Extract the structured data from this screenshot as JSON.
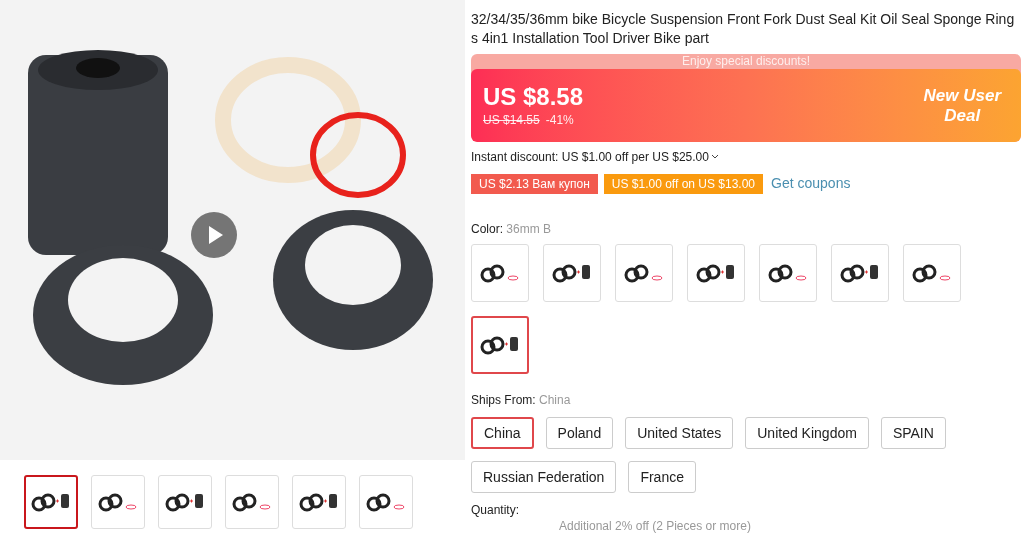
{
  "gallery": {
    "thumbnails": [
      {
        "selected": true
      },
      {
        "selected": false
      },
      {
        "selected": false
      },
      {
        "selected": false
      },
      {
        "selected": false
      },
      {
        "selected": false
      }
    ]
  },
  "title": "32/34/35/36mm bike Bicycle Suspension Front Fork Dust Seal Kit Oil Seal Sponge Rings 4in1 Installation Tool Driver Bike part",
  "price_banner": {
    "header": "Enjoy special discounts!",
    "price": "US $8.58",
    "original_price": "US $14.55",
    "discount": "-41%",
    "deal_label_line_1": "New User",
    "deal_label_line_2": "Deal"
  },
  "instant_discount": "Instant discount: US $1.00 off per US $25.00",
  "coupons": [
    {
      "label": "US $2.13 Вам купон",
      "color": "#f25a4e"
    },
    {
      "label": "US $1.00 off on US $13.00",
      "color": "#fa9a0e"
    }
  ],
  "get_coupons": "Get coupons",
  "color": {
    "label": "Color:",
    "value": "36mm B",
    "swatches": [
      {
        "selected": false,
        "kind": "seals"
      },
      {
        "selected": false,
        "kind": "seals-tool"
      },
      {
        "selected": false,
        "kind": "seals"
      },
      {
        "selected": false,
        "kind": "seals-tool"
      },
      {
        "selected": false,
        "kind": "seals"
      },
      {
        "selected": false,
        "kind": "seals-tool"
      },
      {
        "selected": false,
        "kind": "seals"
      },
      {
        "selected": true,
        "kind": "seals-tool"
      }
    ]
  },
  "ships_from": {
    "label": "Ships From:",
    "value": "China",
    "options": [
      {
        "label": "China",
        "selected": true
      },
      {
        "label": "Poland",
        "selected": false
      },
      {
        "label": "United States",
        "selected": false
      },
      {
        "label": "United Kingdom",
        "selected": false
      },
      {
        "label": "SPAIN",
        "selected": false
      },
      {
        "label": "Russian Federation",
        "selected": false
      },
      {
        "label": "France",
        "selected": false
      }
    ]
  },
  "quantity": {
    "label": "Quantity:",
    "note": "Additional 2% off (2 Pieces or more)"
  }
}
